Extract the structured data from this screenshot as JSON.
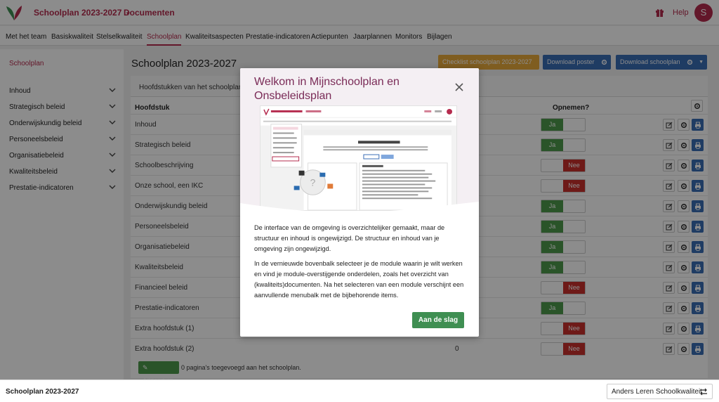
{
  "topbar": {
    "module": "Schoolplan 2023-2027",
    "documents": "Documenten",
    "help": "Help",
    "avatar": "S"
  },
  "nav": [
    "Met het team",
    "Basiskwaliteit",
    "Stelselkwaliteit",
    "Schoolplan",
    "Kwaliteitsaspecten",
    "Prestatie-indicatoren",
    "Actiepunten",
    "Jaarplannen",
    "Monitors",
    "Bijlagen"
  ],
  "nav_active": "Schoolplan",
  "sidebar": {
    "title": "Schoolplan",
    "items": [
      "Inhoud",
      "Strategisch beleid",
      "Onderwijskundig beleid",
      "Personeelsbeleid",
      "Organisatiebeleid",
      "Kwaliteitsbeleid",
      "Prestatie-indicatoren"
    ]
  },
  "main": {
    "title": "Schoolplan 2023-2027",
    "checklist_button": "Checklist schoolplan 2023-2027",
    "poster_button": "Download poster",
    "download_button": "Download schoolplan",
    "card_header": "Hoofdstukken van het schoolplan",
    "col_chapter": "Hoofdstuk",
    "col_include": "Opnemen?",
    "toggle_yes": "Ja",
    "toggle_no": "Nee",
    "rows": [
      {
        "name": "Inhoud",
        "include": "Ja"
      },
      {
        "name": "Strategisch beleid",
        "include": "Ja"
      },
      {
        "name": "Schoolbeschrijving",
        "include": "Nee"
      },
      {
        "name": "Onze school, een IKC",
        "include": "Nee"
      },
      {
        "name": "Onderwijskundig beleid",
        "include": "Ja"
      },
      {
        "name": "Personeelsbeleid",
        "include": "Ja"
      },
      {
        "name": "Organisatiebeleid",
        "include": "Ja"
      },
      {
        "name": "Kwaliteitsbeleid",
        "include": "Ja"
      },
      {
        "name": "Financieel beleid",
        "include": "Nee"
      },
      {
        "name": "Prestatie-indicatoren",
        "include": "Ja"
      },
      {
        "name": "Extra hoofdstuk (1)",
        "include": "Nee"
      },
      {
        "name": "Extra hoofdstuk (2)",
        "include": "Nee"
      }
    ],
    "extra_zero": "0",
    "addendum_button": "Addendum",
    "addendum_text": "0 pagina's toegevoegd aan het schoolplan."
  },
  "footer": {
    "title": "Schoolplan 2023-2027",
    "switch": "Anders Leren Schoolkwaliteit"
  },
  "modal": {
    "title": "Welkom in Mijnschoolplan en Onsbeleidsplan",
    "para1": "De interface van de omgeving is overzichtelijker gemaakt, maar de structuur en inhoud is ongewijzigd. De structuur en inhoud van je omgeving zijn ongewijzigd.",
    "para2": "In de vernieuwde bovenbalk selecteer je de module waarin je wilt werken en vind je module-overstijgende onderdelen, zoals het overzicht van (kwaliteits)documenten. Na het selecteren van een module verschijnt een aanvullende menubalk met de bijbehorende items.",
    "button": "Aan de slag"
  },
  "colors": {
    "brand": "#b52b4e",
    "checklist": "#e8a93b",
    "blue": "#3a6db5",
    "yes": "#4e9a4b",
    "no": "#c9302c",
    "modal_title": "#7a2b57",
    "modal_button": "#3f8f52"
  }
}
